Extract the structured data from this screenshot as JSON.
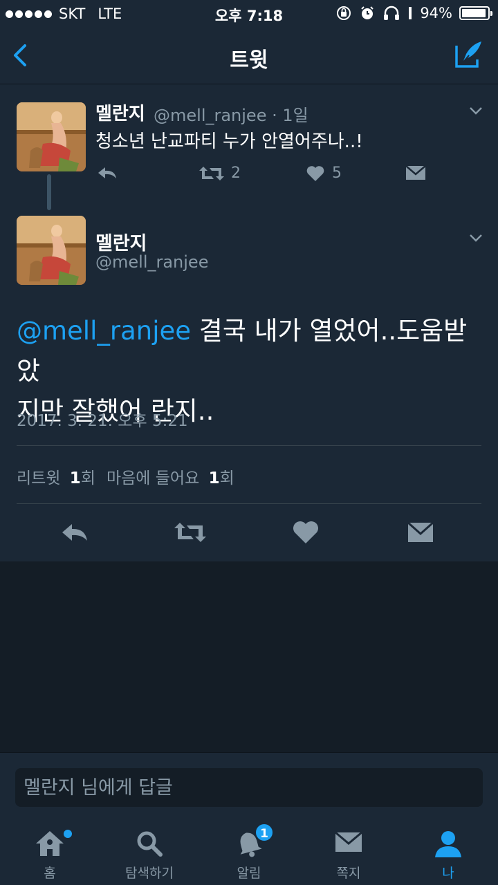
{
  "status_bar": {
    "carrier": "SKT",
    "network": "LTE",
    "time": "오후 7:18",
    "battery": "94%",
    "battery_level": 0.94
  },
  "nav": {
    "title": "트윗"
  },
  "parent_tweet": {
    "name": "멜란지",
    "handle_meta": "@mell_ranjee · 1일",
    "text": "청소년 난교파티 누가 안열어주나..!",
    "retweet_count": "2",
    "like_count": "5"
  },
  "main_tweet": {
    "name": "멜란지",
    "handle": "@mell_ranjee",
    "mention": "@mell_ranjee",
    "text_line1": " 결국 내가 열었어..도움받았",
    "text_line2": "지만 잘했어 란지..",
    "timestamp": "2017. 3. 21. 오후 5:21",
    "retweet_label": "리트윗",
    "retweet_count": "1",
    "retweet_unit": "회",
    "like_label": "마음에 들어요",
    "like_count": "1",
    "like_unit": "회"
  },
  "reply": {
    "placeholder": "멜란지 님에게 답글"
  },
  "tabs": [
    {
      "label": "홈",
      "icon": "home-icon",
      "has_dot": true
    },
    {
      "label": "탐색하기",
      "icon": "search-icon"
    },
    {
      "label": "알림",
      "icon": "bell-icon",
      "badge": "1"
    },
    {
      "label": "쪽지",
      "icon": "envelope-icon"
    },
    {
      "label": "나",
      "icon": "profile-icon",
      "active": true
    }
  ],
  "colors": {
    "accent": "#1da1f2",
    "background": "#141d26",
    "panel": "#1b2836",
    "muted": "#8899a6"
  }
}
